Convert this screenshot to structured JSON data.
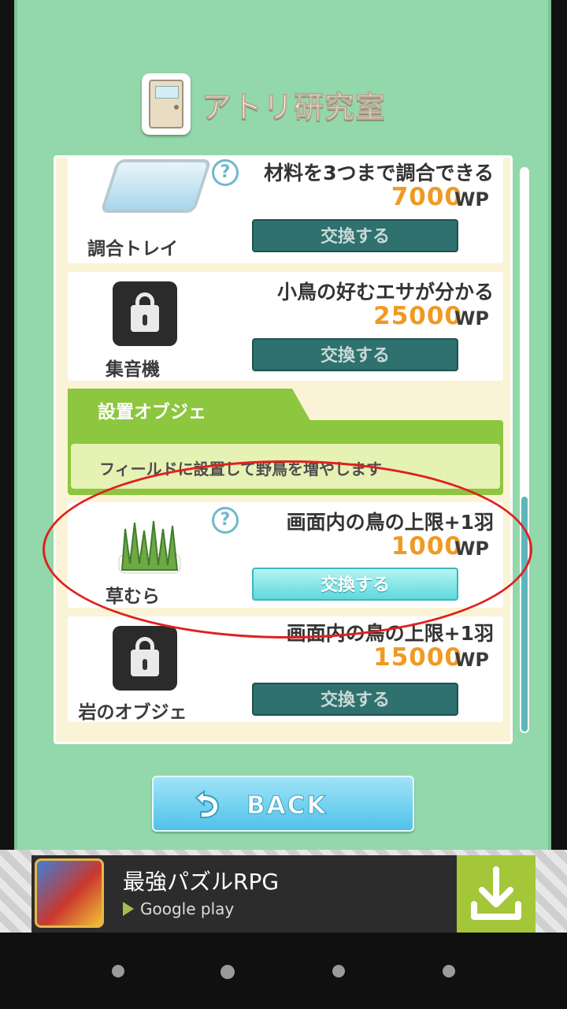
{
  "header": {
    "title": "アトリ研究室"
  },
  "items": [
    {
      "label": "調合トレイ",
      "desc": "材料を3つまで調合できる",
      "price": "7000",
      "unit": "WP",
      "button": "交換する",
      "icon": "tray-icon",
      "locked": false
    },
    {
      "label": "集音機",
      "desc": "小鳥の好むエサが分かる",
      "price": "25000",
      "unit": "WP",
      "button": "交換する",
      "icon": "lock-icon",
      "locked": true
    },
    {
      "label": "草むら",
      "desc": "画面内の鳥の上限+1羽",
      "price": "1000",
      "unit": "WP",
      "button": "交換する",
      "icon": "grass-icon",
      "locked": false
    },
    {
      "label": "岩のオブジェ",
      "desc": "画面内の鳥の上限+1羽",
      "price": "15000",
      "unit": "WP",
      "button": "交換する",
      "icon": "lock-icon",
      "locked": true
    }
  ],
  "section": {
    "title": "設置オブジェ",
    "desc": "フィールドに設置して野鳥を増やします"
  },
  "help_mark": "?",
  "back_button": {
    "label": "BACK"
  },
  "ad": {
    "title": "最強パズルRPG",
    "store": "Google play"
  },
  "colors": {
    "background": "#92d8aa",
    "price": "#ef9a22",
    "accent_green": "#8dc63f",
    "button_dark": "#2e716e",
    "button_active": "#5fd9dc",
    "highlight_ring": "#e02020"
  }
}
